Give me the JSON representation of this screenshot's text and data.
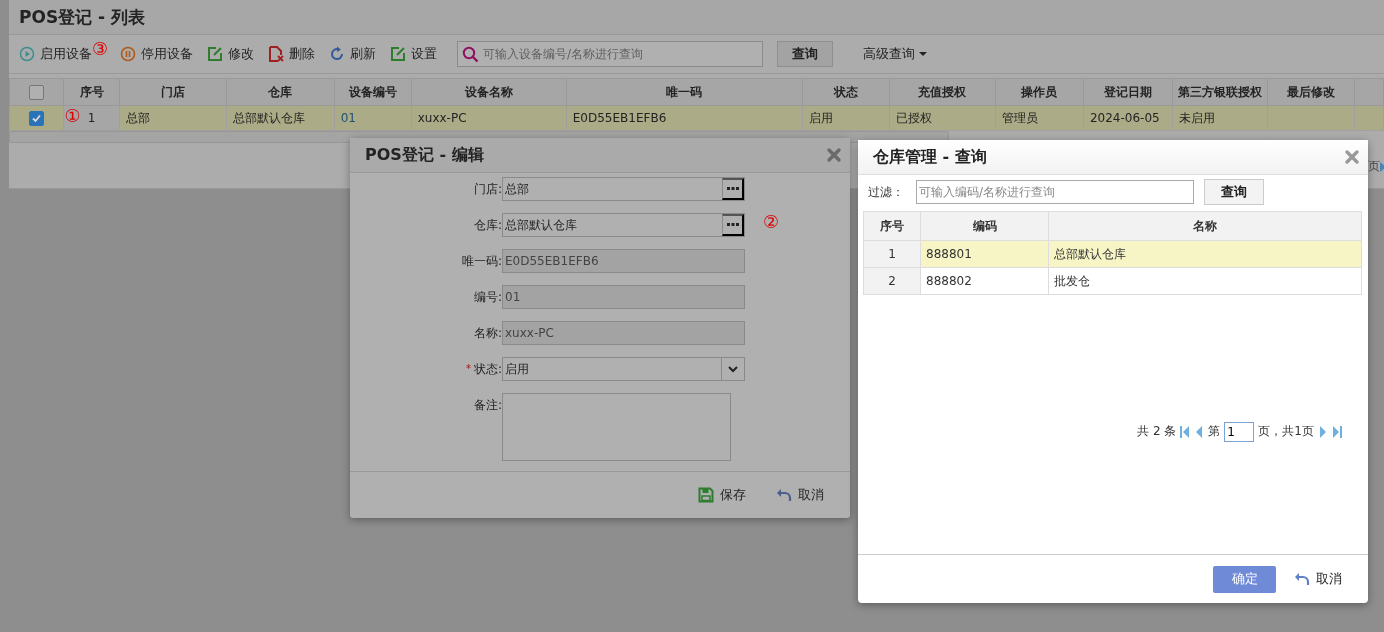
{
  "list_window": {
    "title": "POS登记 - 列表",
    "toolbar": [
      {
        "label": "启用设备",
        "annotation": "③"
      },
      {
        "label": "停用设备"
      },
      {
        "label": "修改"
      },
      {
        "label": "删除"
      },
      {
        "label": "刷新"
      },
      {
        "label": "设置"
      }
    ],
    "search": {
      "placeholder": "可输入设备编号/名称进行查询"
    },
    "search_button": "查询",
    "advanced_query": "高级查询",
    "table": {
      "header_checked": false,
      "columns": [
        "序号",
        "门店",
        "仓库",
        "设备编号",
        "设备名称",
        "唯一码",
        "状态",
        "充值授权",
        "操作员",
        "登记日期",
        "第三方银联授权",
        "最后修改"
      ],
      "rows": [
        {
          "selected": true,
          "checked": true,
          "annotation": "①",
          "cells": [
            "1",
            "总部",
            "总部默认仓库",
            "01",
            "xuxx-PC",
            "E0D55EB1EFB6",
            "启用",
            "已授权",
            "管理员",
            "2024-06-05",
            "未启用",
            ""
          ]
        }
      ]
    },
    "pager_fragment": "页"
  },
  "edit_dialog": {
    "title": "POS登记 - 编辑",
    "fields": [
      {
        "kind": "lookup",
        "label": "门店:",
        "value": "总部"
      },
      {
        "kind": "lookup",
        "label": "仓库:",
        "value": "总部默认仓库",
        "annotation": "②"
      },
      {
        "kind": "readonly",
        "label": "唯一码:",
        "value": "E0D55EB1EFB6"
      },
      {
        "kind": "readonly",
        "label": "编号:",
        "value": "01"
      },
      {
        "kind": "readonly",
        "label": "名称:",
        "value": "xuxx-PC"
      },
      {
        "kind": "select",
        "label": "状态:",
        "value": "启用",
        "required_mark": "*"
      },
      {
        "kind": "textarea",
        "label": "备注:"
      }
    ],
    "buttons": [
      {
        "kind": "save",
        "label": "保存"
      },
      {
        "kind": "cancel",
        "label": "取消"
      }
    ]
  },
  "query_dialog": {
    "title": "仓库管理 - 查询",
    "filter_label": "过滤：",
    "filter": {
      "placeholder": "可输入编码/名称进行查询"
    },
    "query_button": "查询",
    "columns": [
      "序号",
      "编码",
      "名称"
    ],
    "rows": [
      {
        "selected": true,
        "cells": [
          "1",
          "888801",
          "总部默认仓库"
        ]
      },
      {
        "selected": false,
        "cells": [
          "2",
          "888802",
          "批发仓"
        ]
      }
    ],
    "pager": {
      "total": "共 2 条",
      "page_prefix": "第",
      "page": "1",
      "page_suffix": "页，共1页"
    },
    "buttons": [
      {
        "kind": "confirm",
        "label": "确定"
      },
      {
        "kind": "cancel",
        "label": "取消"
      }
    ]
  }
}
